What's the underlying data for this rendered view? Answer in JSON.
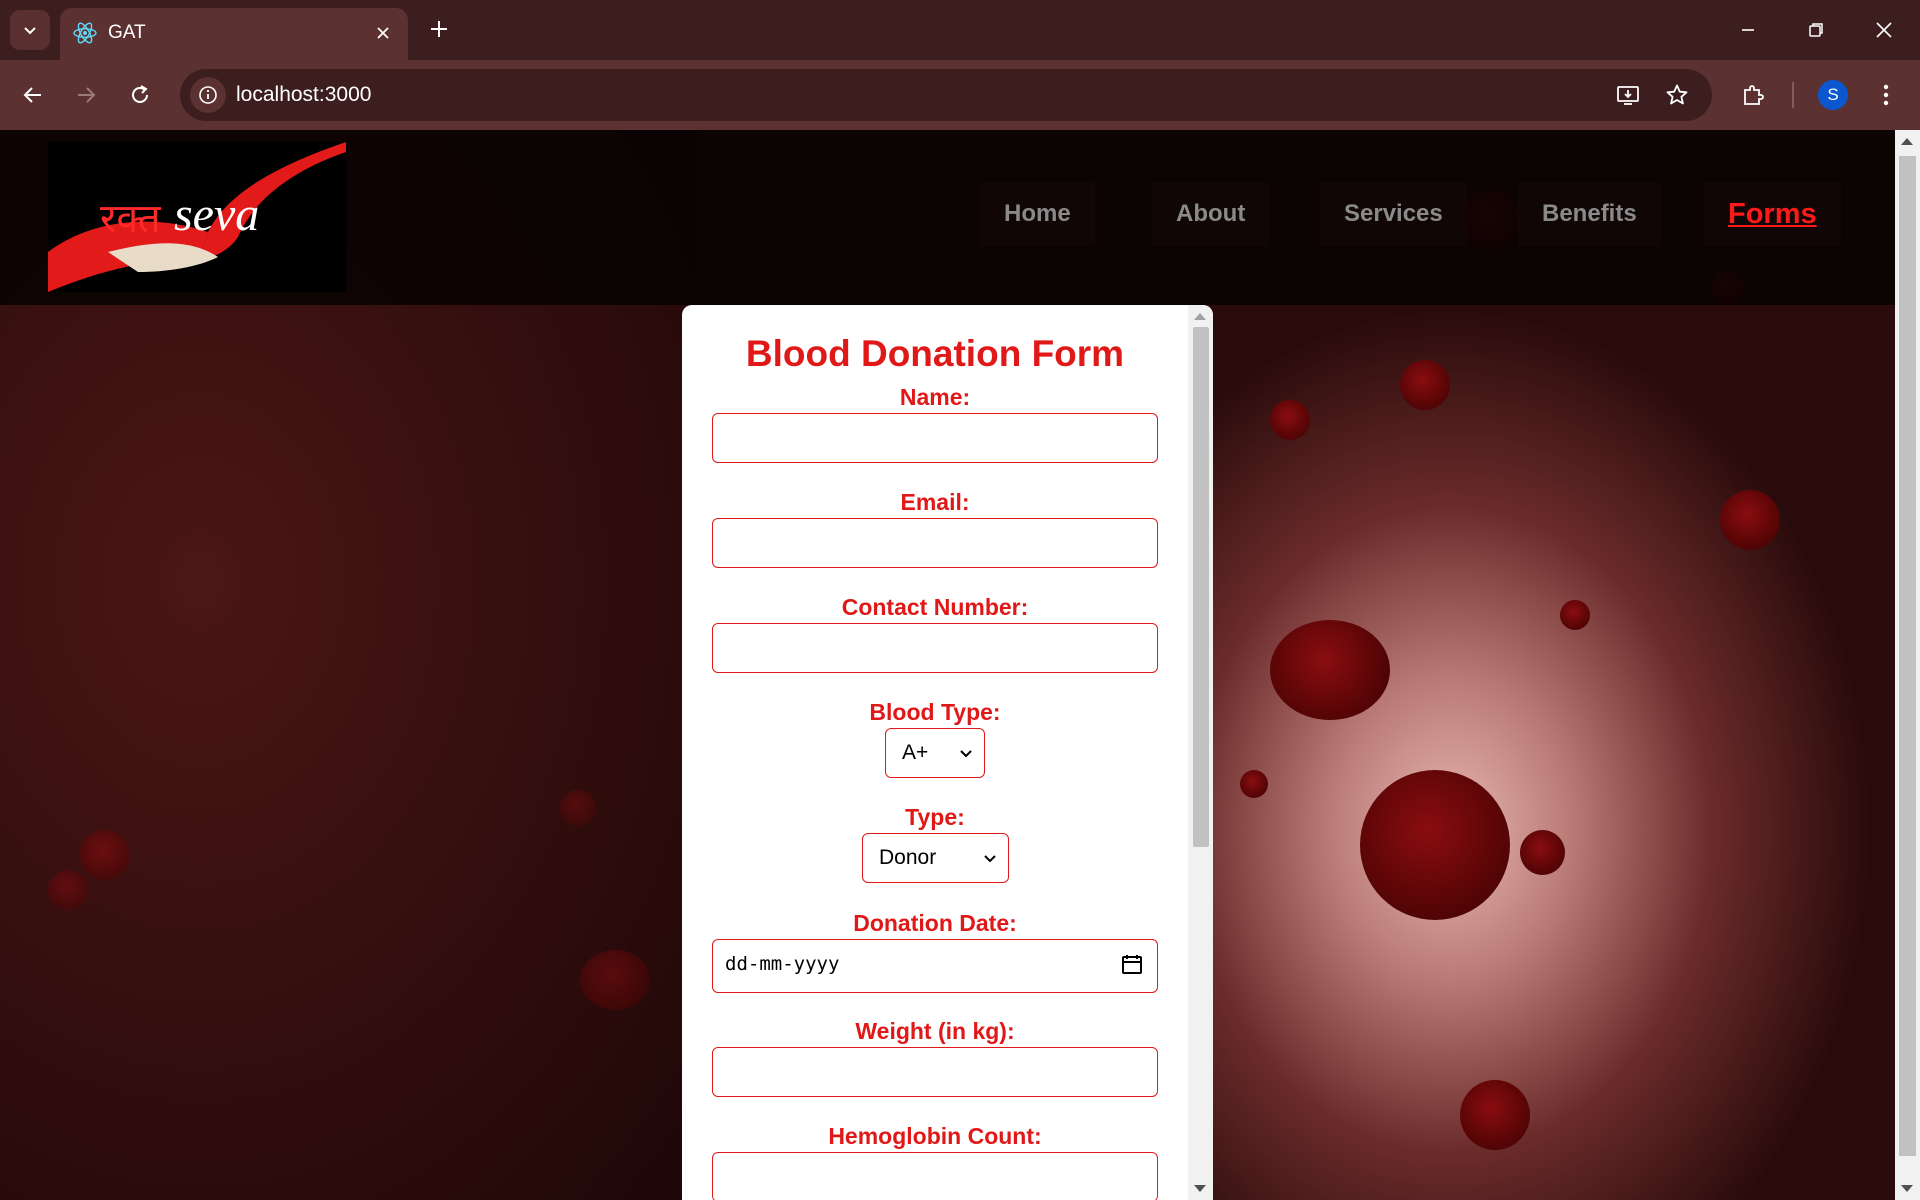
{
  "browser": {
    "tab_title": "GAT",
    "url": "localhost:3000",
    "profile_initial": "S"
  },
  "site": {
    "logo": {
      "devanagari": "रक्त",
      "latin": "seva"
    },
    "nav": [
      {
        "label": "Home",
        "active": false
      },
      {
        "label": "About",
        "active": false
      },
      {
        "label": "Services",
        "active": false
      },
      {
        "label": "Benefits",
        "active": false
      },
      {
        "label": "Forms",
        "active": true
      }
    ]
  },
  "form": {
    "title": "Blood Donation Form",
    "name_label": "Name:",
    "name_value": "",
    "email_label": "Email:",
    "email_value": "",
    "contact_label": "Contact Number:",
    "contact_value": "",
    "blood_type_label": "Blood Type:",
    "blood_type_value": "A+",
    "type_label": "Type:",
    "type_value": "Donor",
    "donation_date_label": "Donation Date:",
    "donation_date_placeholder": "dd-mm-yyyy",
    "weight_label": "Weight (in kg):",
    "weight_value": "",
    "hemoglobin_label": "Hemoglobin Count:",
    "hemoglobin_value": ""
  },
  "colors": {
    "accent": "#e01818",
    "nav_inactive": "#8a8a8a",
    "chrome_dark": "#3c1e1e",
    "chrome_light": "#5b3131"
  }
}
